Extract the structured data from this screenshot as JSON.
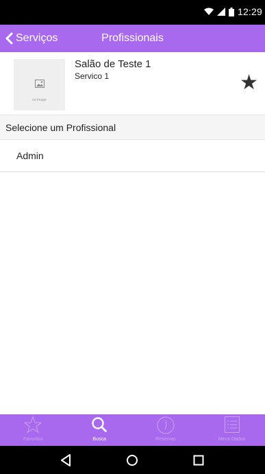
{
  "status_bar": {
    "time": "12:29",
    "icons": [
      "wifi-icon",
      "signal-icon",
      "battery-icon"
    ]
  },
  "nav_bar": {
    "back_label": "Serviços",
    "title": "Profissionais"
  },
  "salon": {
    "name": "Salão de Teste 1",
    "service": "Servico 1",
    "no_image_text": "no image",
    "favorite_icon": "star-icon"
  },
  "section": {
    "title": "Selecione um Profissional"
  },
  "professionals": [
    {
      "name": "Admin"
    }
  ],
  "tabs": [
    {
      "label": "Favoritos",
      "icon": "star-outline-icon",
      "active": false
    },
    {
      "label": "Busca",
      "icon": "search-icon",
      "active": true
    },
    {
      "label": "Reservas",
      "icon": "clock-icon",
      "active": false
    },
    {
      "label": "Meus Dados",
      "icon": "list-icon",
      "active": false
    }
  ],
  "colors": {
    "accent": "#a869ee",
    "tab_inactive": "#c9a4f4",
    "tab_active": "#ffffff"
  }
}
